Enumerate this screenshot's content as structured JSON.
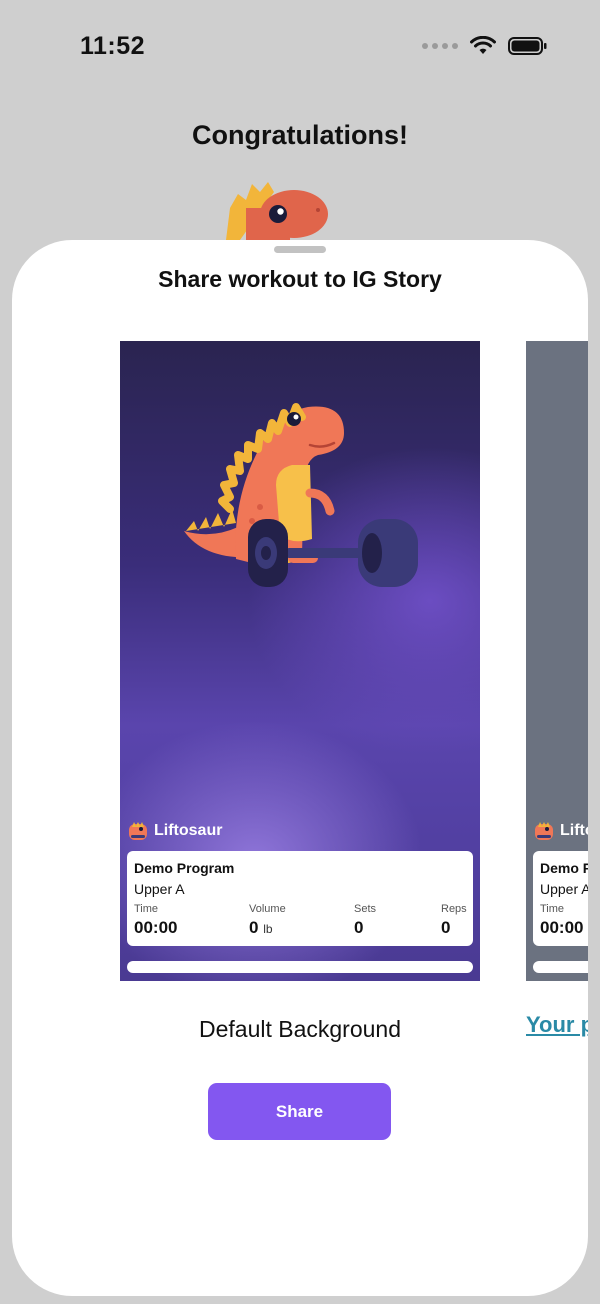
{
  "status_bar": {
    "time": "11:52"
  },
  "background": {
    "title": "Congratulations!"
  },
  "sheet": {
    "title": "Share workout to IG Story",
    "cards": [
      {
        "brand": "Liftosaur",
        "program": "Demo Program",
        "day": "Upper A",
        "stats": {
          "time_label": "Time",
          "time_value": "00:00",
          "volume_label": "Volume",
          "volume_value": "0",
          "volume_unit": "lb",
          "sets_label": "Sets",
          "sets_value": "0",
          "reps_label": "Reps",
          "reps_value": "0"
        },
        "caption": "Default Background"
      },
      {
        "brand": "Lifto",
        "program": "Demo P",
        "day": "Upper A",
        "time_label": "Time",
        "time_value": "00:00",
        "caption": "Your p"
      }
    ],
    "share_label": "Share"
  },
  "colors": {
    "accent": "#8357f0",
    "link": "#2a8aa6",
    "card_gradient_top": "#2a2450",
    "card_gradient_mid": "#5a45ad"
  }
}
